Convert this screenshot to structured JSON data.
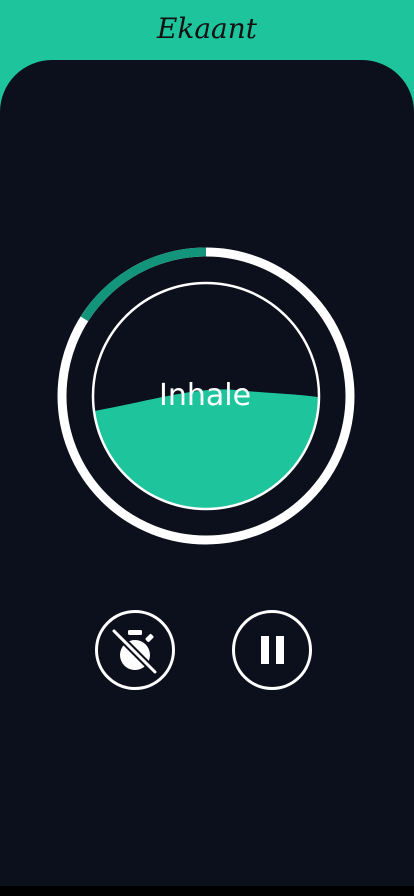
{
  "app": {
    "title": "Ekaant"
  },
  "breathing": {
    "phase": "Inhale",
    "session_progress": 0.16,
    "fill_level": 0.5
  },
  "controls": {
    "timer_icon": "timer-off-icon",
    "pause_icon": "pause-icon"
  },
  "colors": {
    "accent": "#1ec49c",
    "progress": "#12957a",
    "background": "#0c0f1c",
    "ring": "#ffffff"
  }
}
